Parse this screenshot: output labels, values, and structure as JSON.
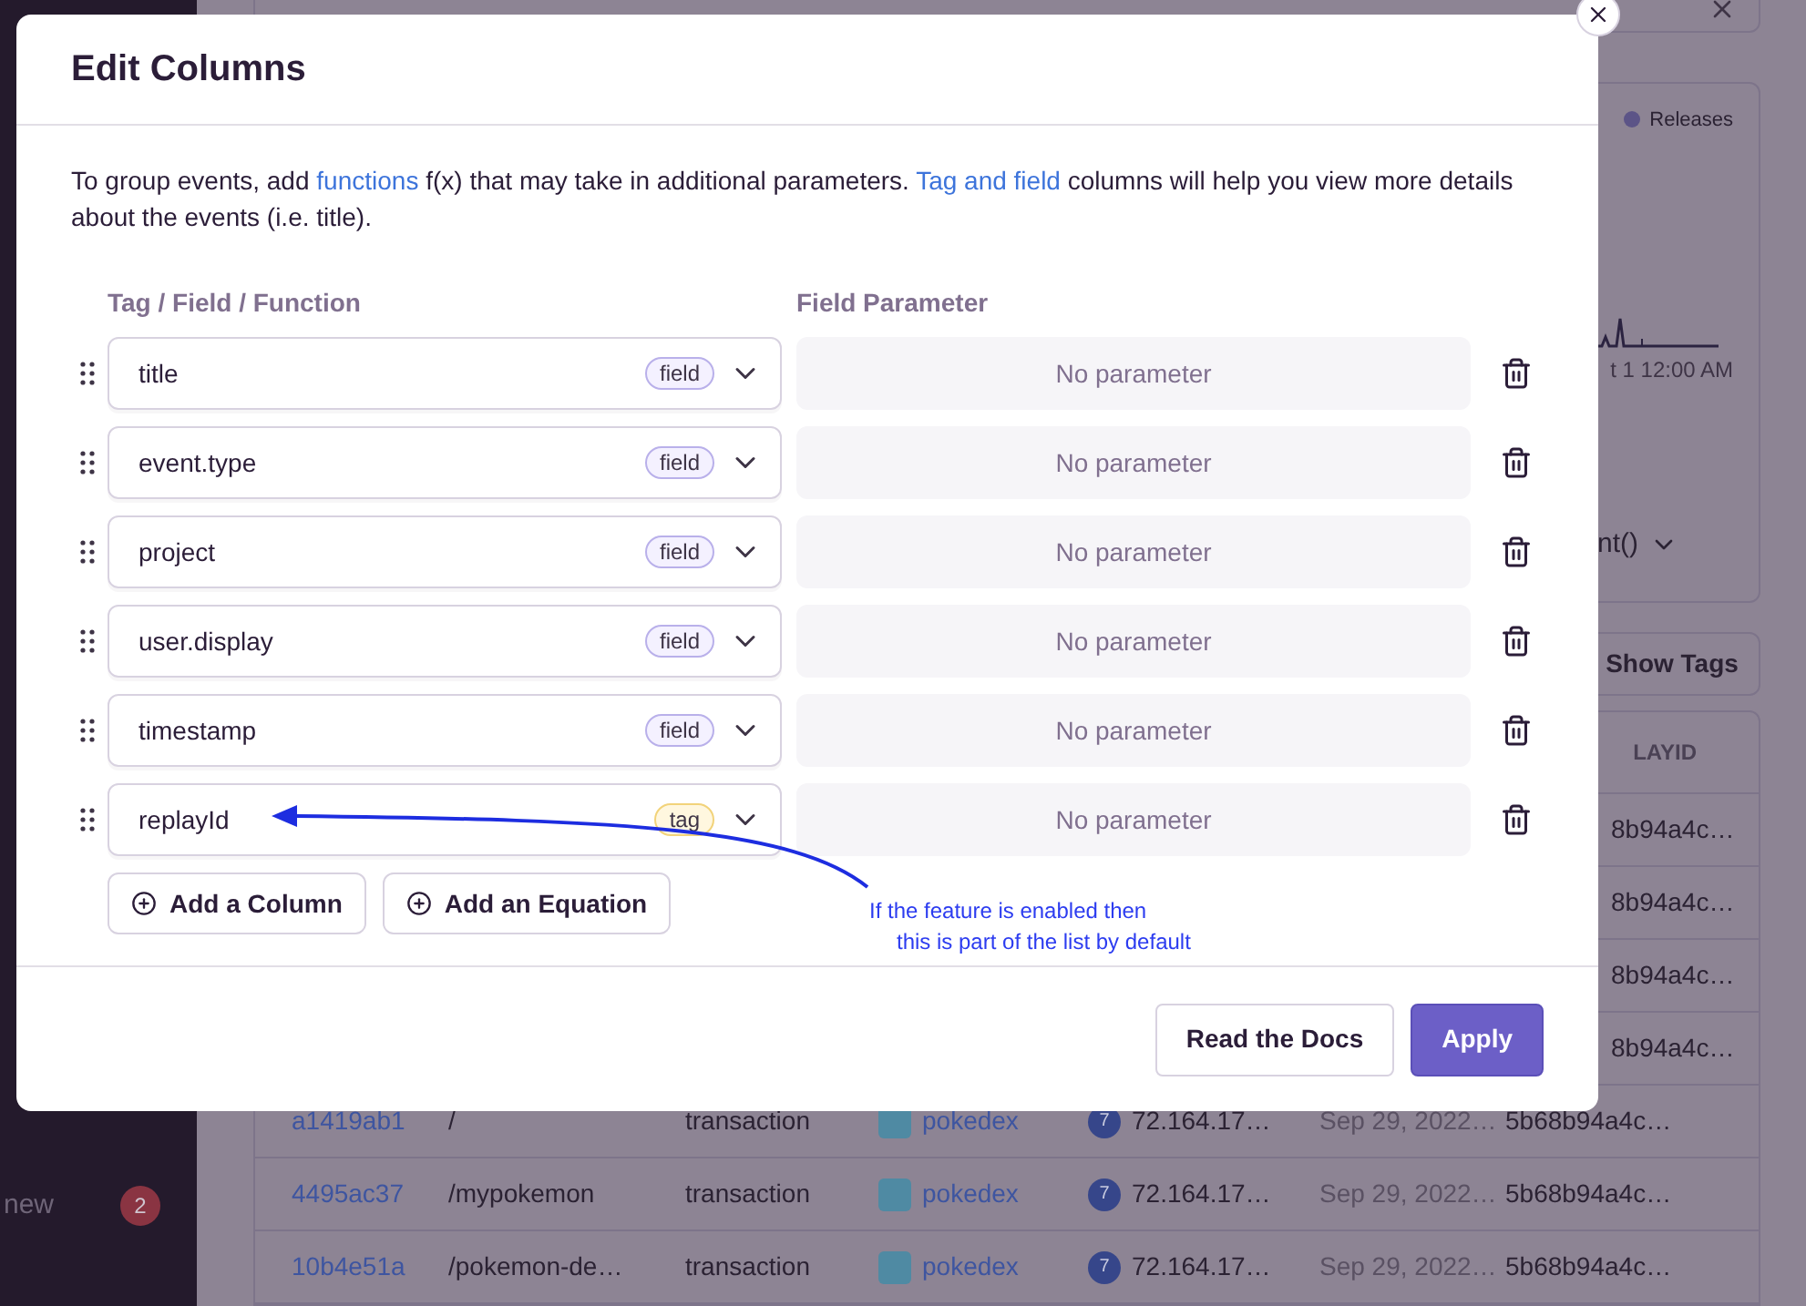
{
  "background": {
    "sidebar_items": [
      {
        "label": "new",
        "badge": "2"
      }
    ],
    "chart": {
      "legend": "Releases",
      "axis_label": "t 1 12:00 AM",
      "dropdown": "nt()"
    },
    "show_tags_button": "Show Tags",
    "table": {
      "column_header": "LAYID",
      "rows": [
        {
          "replayid": "8b94a4c…"
        },
        {
          "replayid": "8b94a4c…"
        },
        {
          "replayid": "8b94a4c…"
        },
        {
          "replayid": "8b94a4c…"
        },
        {
          "id": "a1419ab1",
          "name": "/",
          "type": "transaction",
          "project": "pokedex",
          "avatar": "7",
          "user": "72.164.17…",
          "timestamp": "Sep 29, 2022…",
          "replayid": "5b68b94a4c…"
        },
        {
          "id": "4495ac37",
          "name": "/mypokemon",
          "type": "transaction",
          "project": "pokedex",
          "avatar": "7",
          "user": "72.164.17…",
          "timestamp": "Sep 29, 2022…",
          "replayid": "5b68b94a4c…"
        },
        {
          "id": "10b4e51a",
          "name": "/pokemon-de…",
          "type": "transaction",
          "project": "pokedex",
          "avatar": "7",
          "user": "72.164.17…",
          "timestamp": "Sep 29, 2022…",
          "replayid": "5b68b94a4c…"
        }
      ]
    }
  },
  "modal": {
    "title": "Edit Columns",
    "description": [
      {
        "text": "To group events, add "
      },
      {
        "text": "functions",
        "link": true
      },
      {
        "text": " f(x) that may take in additional parameters. "
      },
      {
        "text": "Tag and field",
        "link": true
      },
      {
        "text": " columns will help you view more details about the events (i.e. title)."
      }
    ],
    "column_headers": [
      "Tag / Field / Function",
      "Field Parameter"
    ],
    "columns": [
      {
        "name": "title",
        "badge": "field",
        "kind": "field",
        "parameter": "No parameter"
      },
      {
        "name": "event.type",
        "badge": "field",
        "kind": "field",
        "parameter": "No parameter"
      },
      {
        "name": "project",
        "badge": "field",
        "kind": "field",
        "parameter": "No parameter"
      },
      {
        "name": "user.display",
        "badge": "field",
        "kind": "field",
        "parameter": "No parameter"
      },
      {
        "name": "timestamp",
        "badge": "field",
        "kind": "field",
        "parameter": "No parameter"
      },
      {
        "name": "replayId",
        "badge": "tag",
        "kind": "tag",
        "parameter": "No parameter"
      }
    ],
    "add_buttons": [
      "Add a Column",
      "Add an Equation"
    ],
    "annotation": [
      "If the feature is enabled then",
      "this is part of the list by default"
    ],
    "footer_buttons": [
      {
        "label": "Read the Docs",
        "kind": "secondary"
      },
      {
        "label": "Apply",
        "kind": "primary"
      }
    ]
  }
}
